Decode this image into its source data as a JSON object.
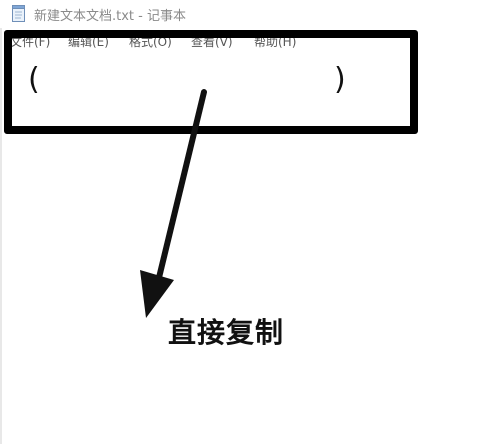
{
  "window": {
    "title": "新建文本文档.txt - 记事本",
    "app_icon": "notepad-icon"
  },
  "menu": {
    "items": [
      {
        "label": "文件(F)"
      },
      {
        "label": "编辑(E)"
      },
      {
        "label": "格式(O)"
      },
      {
        "label": "查看(V)"
      },
      {
        "label": "帮助(H)"
      }
    ]
  },
  "editor": {
    "open_paren": "(",
    "close_paren": ")"
  },
  "annotation": {
    "caption": "直接复制",
    "box_color": "#000000",
    "arrow_color": "#111111",
    "arrow_icon": "arrow-down-left-icon"
  }
}
